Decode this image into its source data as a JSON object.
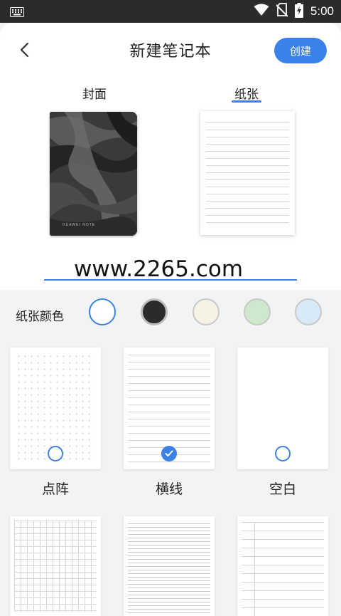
{
  "status_bar": {
    "time": "5:00",
    "left_icon": "keyboard-icon",
    "icons": [
      "wifi-icon",
      "no-sim-icon",
      "battery-charging-icon"
    ]
  },
  "header": {
    "back_icon": "chevron-left-icon",
    "title": "新建笔记本",
    "create_label": "创建"
  },
  "tabs": [
    {
      "label": "封面",
      "selected": false
    },
    {
      "label": "纸张",
      "selected": true
    }
  ],
  "cover": {
    "brand_text": "HUAWEI NOTE"
  },
  "name_field": {
    "value": "www.2265.com"
  },
  "paper_color": {
    "label": "纸张颜色",
    "swatches": [
      {
        "color": "#ffffff",
        "selected": true
      },
      {
        "color": "#2b2b2b",
        "selected": false
      },
      {
        "color": "#f6f3e4",
        "selected": false
      },
      {
        "color": "#cfe7cc",
        "selected": false
      },
      {
        "color": "#d8eafa",
        "selected": false
      }
    ]
  },
  "paper_types": [
    {
      "label": "点阵",
      "pattern": "dots",
      "selected": false
    },
    {
      "label": "横线",
      "pattern": "ruled",
      "selected": true
    },
    {
      "label": "空白",
      "pattern": "blank",
      "selected": false
    },
    {
      "label": "",
      "pattern": "grid",
      "selected": false
    },
    {
      "label": "",
      "pattern": "narrow-ruled",
      "selected": false
    },
    {
      "label": "",
      "pattern": "cornell",
      "selected": false
    }
  ],
  "colors": {
    "accent": "#3b82e8",
    "page_bg": "#f1f3f5"
  }
}
